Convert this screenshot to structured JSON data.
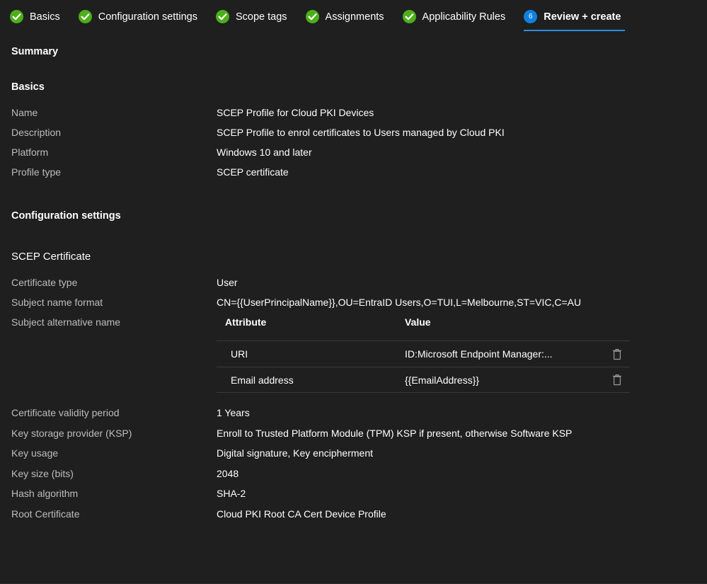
{
  "wizard": {
    "tabs": [
      {
        "label": "Basics",
        "state": "completed",
        "icon": "check-circle-icon"
      },
      {
        "label": "Configuration settings",
        "state": "completed",
        "icon": "check-circle-icon"
      },
      {
        "label": "Scope tags",
        "state": "completed",
        "icon": "check-circle-icon"
      },
      {
        "label": "Assignments",
        "state": "completed",
        "icon": "check-circle-icon"
      },
      {
        "label": "Applicability Rules",
        "state": "completed",
        "icon": "check-circle-icon"
      },
      {
        "label": "Review + create",
        "state": "current",
        "step_number": "6",
        "icon": "step-number-badge"
      }
    ],
    "completed_color": "#4caf19",
    "current_color": "#0f80e0",
    "underline_color": "#2a8fe0"
  },
  "headings": {
    "summary": "Summary",
    "basics": "Basics",
    "configuration_settings": "Configuration settings",
    "scep_certificate": "SCEP Certificate"
  },
  "basics": {
    "rows": [
      {
        "label": "Name",
        "value": "SCEP Profile for Cloud PKI Devices"
      },
      {
        "label": "Description",
        "value": "SCEP Profile to enrol certificates to Users managed by Cloud PKI"
      },
      {
        "label": "Platform",
        "value": "Windows 10 and later"
      },
      {
        "label": "Profile type",
        "value": "SCEP certificate"
      }
    ]
  },
  "scep": {
    "certificate_type": {
      "label": "Certificate type",
      "value": "User"
    },
    "subject_name_format": {
      "label": "Subject name format",
      "value": "CN={{UserPrincipalName}},OU=EntraID Users,O=TUI,L=Melbourne,ST=VIC,C=AU"
    },
    "subject_alternative_name": {
      "label": "Subject alternative name",
      "table": {
        "columns": [
          "Attribute",
          "Value"
        ],
        "rows": [
          {
            "attribute": "URI",
            "value": "ID:Microsoft Endpoint Manager:...",
            "delete_icon": "trash-icon"
          },
          {
            "attribute": "Email address",
            "value": "{{EmailAddress}}",
            "delete_icon": "trash-icon"
          }
        ]
      }
    },
    "details": [
      {
        "label": "Certificate validity period",
        "value": "1 Years"
      },
      {
        "label": "Key storage provider (KSP)",
        "value": "Enroll to Trusted Platform Module (TPM) KSP if present, otherwise Software KSP"
      },
      {
        "label": "Key usage",
        "value": "Digital signature, Key encipherment"
      },
      {
        "label": "Key size (bits)",
        "value": "2048"
      },
      {
        "label": "Hash algorithm",
        "value": "SHA-2"
      },
      {
        "label": "Root Certificate",
        "value": "Cloud PKI Root CA Cert Device Profile"
      }
    ]
  }
}
